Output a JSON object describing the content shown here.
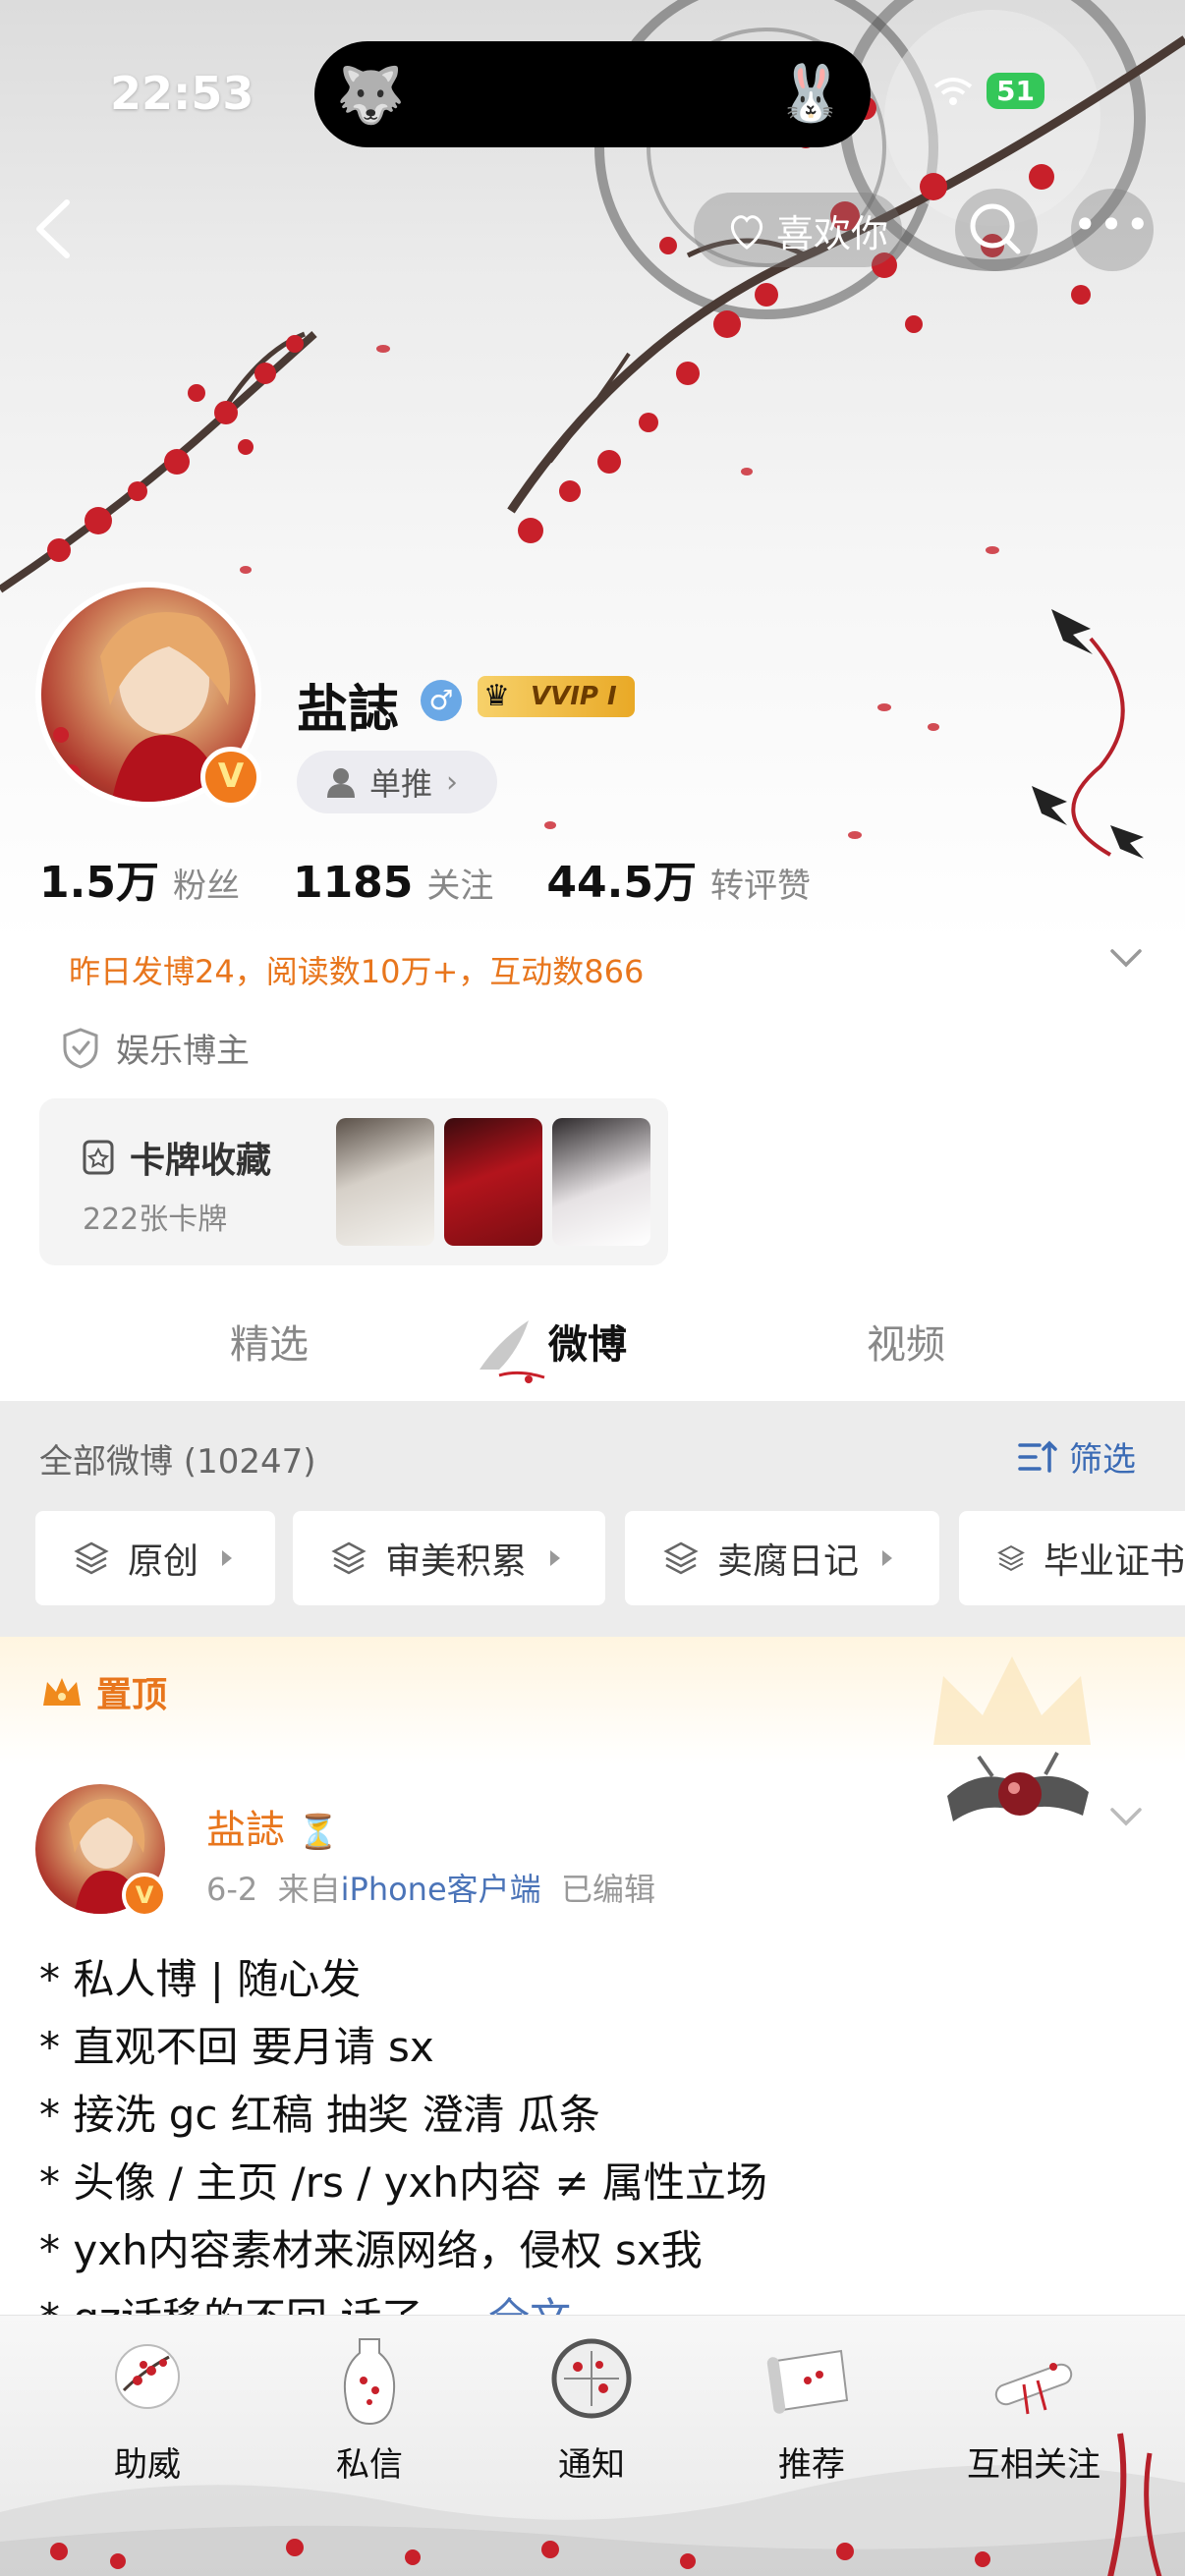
{
  "status_bar": {
    "time": "22:53",
    "battery": "51"
  },
  "nav": {
    "like_label": "喜欢你"
  },
  "profile": {
    "name": "盐誌",
    "vvip": "VVIP I",
    "single_push": "单推",
    "stats": [
      {
        "value": "1.5万",
        "label": "粉丝"
      },
      {
        "value": "1185",
        "label": "关注"
      },
      {
        "value": "44.5万",
        "label": "转评赞"
      }
    ],
    "yesterday": "昨日发博24，阅读数10万+，互动数866",
    "certification": "娱乐博主",
    "card_collection": {
      "title": "卡牌收藏",
      "count": "222张卡牌"
    }
  },
  "tabs": [
    {
      "label": "精选"
    },
    {
      "label": "微博"
    },
    {
      "label": "视频"
    }
  ],
  "feed": {
    "all_label": "全部微博 (10247)",
    "filter_label": "筛选",
    "chips": [
      {
        "label": "原创"
      },
      {
        "label": "审美积累"
      },
      {
        "label": "卖腐日记"
      },
      {
        "label": "毕业证书"
      }
    ]
  },
  "pinned": {
    "label": "置顶",
    "author": "盐誌",
    "date": "6-2",
    "from_prefix": "来自",
    "source": "iPhone客户端",
    "edited": "已编辑",
    "lines": [
      "* 私人博 | 随心发",
      "* 直观不回 要月请 sx",
      "* 接洗 gc  红稿 抽奖 澄清 瓜条",
      "* 头像 / 主页 /rs / yxh内容 ≠ 属性立场",
      "* yxh内容素材来源网络，侵权 sx我"
    ],
    "partial_line": "* gz话移的不回 话了 ... ",
    "more": "全文"
  },
  "bottom_nav": [
    {
      "label": "助威"
    },
    {
      "label": "私信"
    },
    {
      "label": "通知"
    },
    {
      "label": "推荐"
    },
    {
      "label": "互相关注"
    }
  ],
  "colors": {
    "accent_orange": "#e8761d",
    "link_blue": "#4b74b8",
    "plum_red": "#c8202a"
  }
}
